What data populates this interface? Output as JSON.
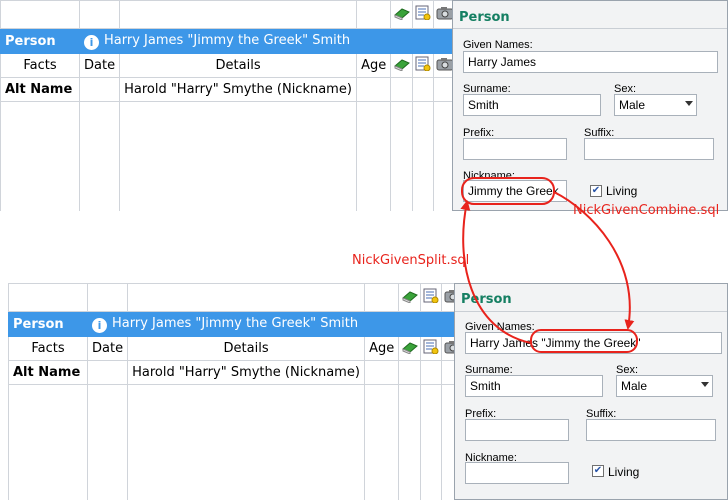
{
  "top": {
    "grid": {
      "person_label": "Person",
      "person_name": "Harry James \"Jimmy the Greek\" Smith",
      "headers": {
        "facts": "Facts",
        "date": "Date",
        "details": "Details",
        "age": "Age"
      },
      "alt_name_label": "Alt Name",
      "alt_name_details": "Harold \"Harry\" Smythe (Nickname)"
    },
    "panel": {
      "title": "Person",
      "given_names_label": "Given Names:",
      "given_names_value": "Harry James",
      "surname_label": "Surname:",
      "surname_value": "Smith",
      "sex_label": "Sex:",
      "sex_value": "Male",
      "prefix_label": "Prefix:",
      "prefix_value": "",
      "suffix_label": "Suffix:",
      "suffix_value": "",
      "nickname_label": "Nickname:",
      "nickname_value": "Jimmy the Greek",
      "living_label": "Living",
      "living_checked": true
    }
  },
  "bottom": {
    "grid": {
      "person_label": "Person",
      "person_name": "Harry James \"Jimmy the Greek\" Smith",
      "headers": {
        "facts": "Facts",
        "date": "Date",
        "details": "Details",
        "age": "Age"
      },
      "alt_name_label": "Alt Name",
      "alt_name_details": "Harold \"Harry\" Smythe (Nickname)"
    },
    "panel": {
      "title": "Person",
      "given_names_label": "Given Names:",
      "given_names_value": "Harry James \"Jimmy the Greek\"",
      "surname_label": "Surname:",
      "surname_value": "Smith",
      "sex_label": "Sex:",
      "sex_value": "Male",
      "prefix_label": "Prefix:",
      "prefix_value": "",
      "suffix_label": "Suffix:",
      "suffix_value": "",
      "nickname_label": "Nickname:",
      "nickname_value": "",
      "living_label": "Living",
      "living_checked": true
    }
  },
  "annotations": {
    "combine_label": "NickGivenCombine.sql",
    "split_label": "NickGivenSplit.sql",
    "color": "#e8231c"
  },
  "colors": {
    "person_row": "#3d97e8",
    "panel_title": "#157f62",
    "panel_bg": "#f2f3f4"
  },
  "icons": [
    "book-icon",
    "note-icon",
    "camera-icon",
    "person-icon",
    "dropdown-arrow-icon",
    "checkmark-icon"
  ]
}
